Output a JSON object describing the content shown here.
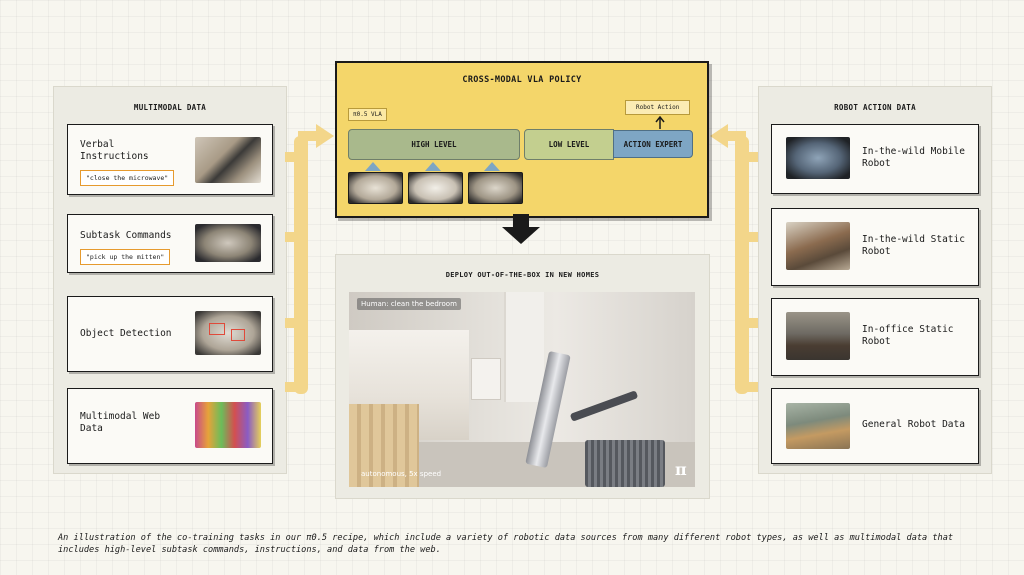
{
  "left_panel": {
    "title": "MULTIMODAL DATA",
    "items": [
      {
        "label": "Verbal Instructions",
        "quote": "\"close the microwave\""
      },
      {
        "label": "Subtask Commands",
        "quote": "\"pick up the mitten\""
      },
      {
        "label": "Object Detection"
      },
      {
        "label": "Multimodal Web Data"
      }
    ]
  },
  "right_panel": {
    "title": "ROBOT ACTION DATA",
    "items": [
      {
        "label": "In-the-wild Mobile Robot"
      },
      {
        "label": "In-the-wild Static Robot"
      },
      {
        "label": "In-office Static Robot"
      },
      {
        "label": "General Robot Data"
      }
    ]
  },
  "policy": {
    "title": "CROSS-MODAL VLA POLICY",
    "model_tag": "π0.5 VLA",
    "robot_action": "Robot Action",
    "high_level": "HIGH LEVEL",
    "low_level": "LOW LEVEL",
    "action_expert": "ACTION EXPERT"
  },
  "deploy": {
    "title": "DEPLOY OUT-OF-THE-BOX IN NEW HOMES",
    "prompt_overlay": "Human: clean the bedroom",
    "speed_overlay": "autonomous, 5x speed",
    "logo": "π"
  },
  "caption": "An illustration of the co-training tasks in our π0.5 recipe, which include a variety of robotic data sources from many different robot types, as well as multimodal data that includes high-level subtask commands, instructions, and data from the web.",
  "colors": {
    "policy_yellow": "#f4d66a",
    "high_level_green": "#a9b98c",
    "action_expert_blue": "#7ea6c4",
    "arrow_yellow": "#f3d68a",
    "quote_border": "#e69a2e"
  }
}
